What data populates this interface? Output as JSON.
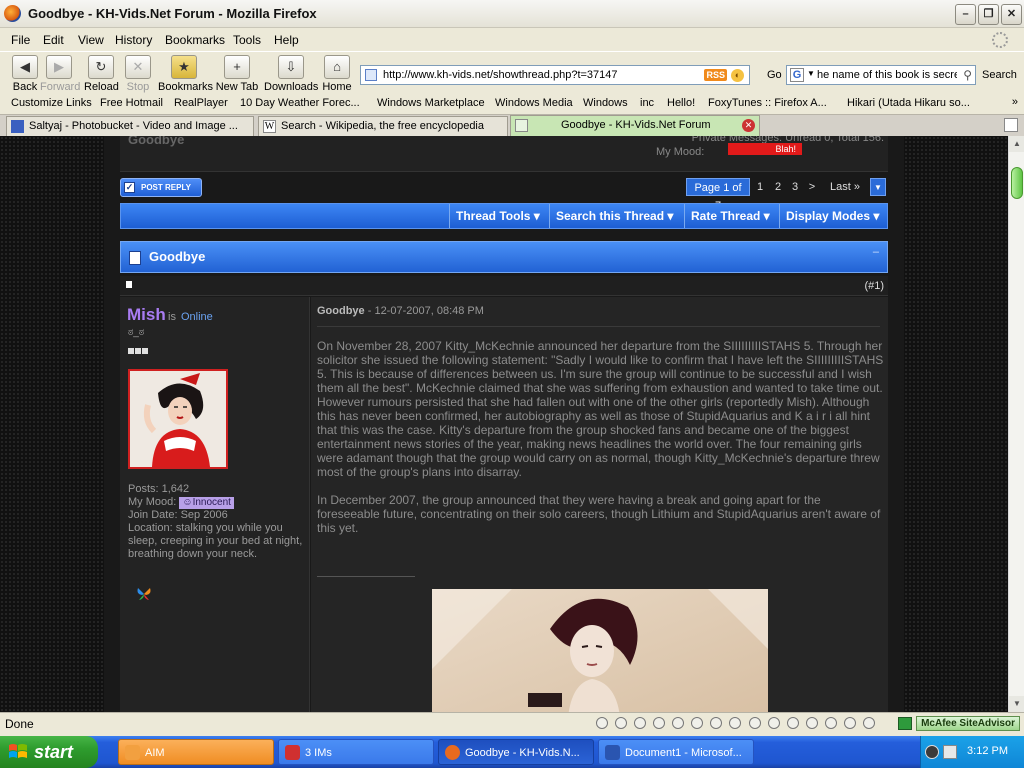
{
  "window": {
    "title": "Goodbye - KH-Vids.Net Forum - Mozilla Firefox",
    "minimize": "–",
    "maximize": "❐",
    "close": "✕"
  },
  "menu": [
    "File",
    "Edit",
    "View",
    "History",
    "Bookmarks",
    "Tools",
    "Help"
  ],
  "nav": {
    "back": "Back",
    "forward": "Forward",
    "reload": "Reload",
    "stop": "Stop",
    "bookmarks": "Bookmarks",
    "new_tab": "New Tab",
    "downloads": "Downloads",
    "home": "Home",
    "url": "http://www.kh-vids.net/showthread.php?t=37147",
    "rss": "RSS",
    "go": "Go",
    "search_value": "he name of this book is secre",
    "search_label": "Search"
  },
  "bookmarks": [
    "Customize Links",
    "Free Hotmail",
    "RealPlayer",
    "10 Day Weather Forec...",
    "Windows Marketplace",
    "Windows Media",
    "Windows",
    "inc",
    "Hello!",
    "FoxyTunes :: Firefox A...",
    "Hikari (Utada Hikaru so..."
  ],
  "bookmarks_more": "»",
  "tabs": [
    {
      "label": "Saltyaj - Photobucket - Video and Image ..."
    },
    {
      "label": "Search - Wikipedia, the free encyclopedia"
    },
    {
      "label": "Goodbye - KH-Vids.Net Forum",
      "active": true
    }
  ],
  "forum": {
    "prev_title": "Goodbye",
    "prev_pm": "Private Messages: Unread 0, Total 156.",
    "prev_mood_label": "My Mood:",
    "prev_mood_badge": "Blah!",
    "post_reply": "POST REPLY",
    "pager": {
      "label": "Page 1 of 7",
      "pages": [
        "1",
        "2",
        "3"
      ],
      "next": ">",
      "last": "Last »",
      "dropdown": "▼"
    },
    "tools": [
      "Thread Tools ▾",
      "Search this Thread ▾",
      "Rate Thread ▾",
      "Display Modes ▾"
    ],
    "thread_title": "Goodbye",
    "collapse": "–",
    "post_number": "(#1)",
    "user": {
      "name": "Mish",
      "is": "is",
      "status": "Online",
      "title": "ಠ_ಠ",
      "posts": "Posts: 1,642",
      "mood_label": "My Mood:",
      "mood": "Innocent",
      "join_date": "Join Date: Sep 2006",
      "location": "Location: stalking you while you sleep, creeping in your bed at night, breathing down your neck."
    },
    "post": {
      "title": "Goodbye",
      "date": " - 12-07-2007, 08:48 PM",
      "paragraphs": [
        "On November 28, 2007 Kitty_McKechnie announced her departure from the SIIIIIIIIISTAHS 5. Through her solicitor she issued the following statement: \"Sadly I would like to confirm that I have left the SIIIIIIIIISTAHS 5. This is because of differences between us. I'm sure the group will continue to be successful and I wish them all the best\". McKechnie claimed that she was suffering from exhaustion and wanted to take time out. However rumours persisted that she had fallen out with one of the other girls (reportedly Mish). Although this has never been confirmed, her autobiography as well as those of StupidAquarius and K a i r i all hint that this was the case. Kitty's departure from the group shocked fans and became one of the biggest entertainment news stories of the year, making news headlines the world over. The four remaining girls were adamant though that the group would carry on as normal, though Kitty_McKechnie's departure threw most of the group's plans into disarray.",
        "In December 2007, the group announced that they were having a break and going apart for the foreseeable future, concentrating on their solo careers, though Lithium and StupidAquarius aren't aware of this yet."
      ]
    }
  },
  "status": {
    "text": "Done",
    "mcafee": "McAfee SiteAdvisor"
  },
  "taskbar": {
    "start": "start",
    "items": [
      {
        "label": "AIM",
        "color": "#f2a040"
      },
      {
        "label": "3 IMs",
        "color": "#d03030"
      },
      {
        "label": "Goodbye - KH-Vids.N...",
        "color": "#e86a1f"
      },
      {
        "label": "Document1 - Microsof...",
        "color": "#2a55b0"
      }
    ],
    "clock": "3:12 PM"
  },
  "colors": {
    "forum_blue": "#2a6bd8",
    "username": "#a97cf2",
    "online": "#6aa2f0",
    "active_tab": "#c8e6b4"
  }
}
